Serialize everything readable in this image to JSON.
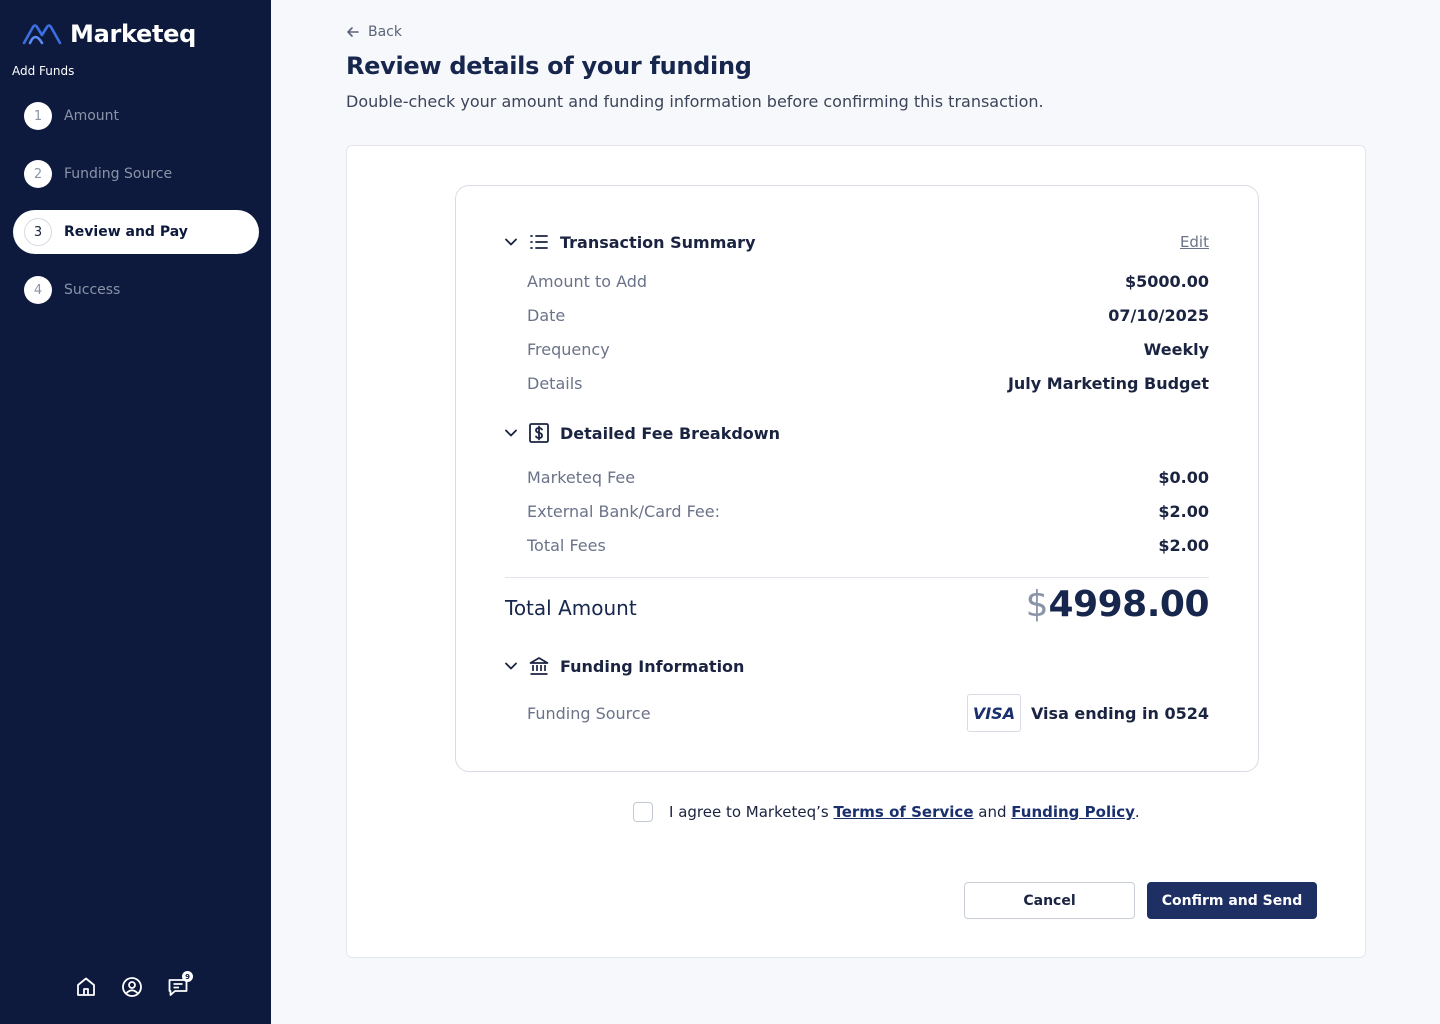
{
  "brand": {
    "name": "Marketeq",
    "accent": "#3b82f6",
    "sidebar_bg": "#0e1a3d",
    "primary_button": "#1d2f63"
  },
  "sidebar": {
    "heading": "Add Funds",
    "steps": [
      {
        "num": "1",
        "label": "Amount",
        "active": false
      },
      {
        "num": "2",
        "label": "Funding Source",
        "active": false
      },
      {
        "num": "3",
        "label": "Review and Pay",
        "active": true
      },
      {
        "num": "4",
        "label": "Success",
        "active": false
      }
    ],
    "bottom_icons": [
      "home-icon",
      "profile-icon",
      "messages-icon"
    ],
    "messages_badge": "9"
  },
  "header": {
    "back_label": "Back",
    "title": "Review details of your funding",
    "subtitle": "Double-check your amount and funding information before confirming this transaction."
  },
  "transaction_summary": {
    "title": "Transaction Summary",
    "edit_label": "Edit",
    "rows": [
      {
        "label": "Amount to Add",
        "value": "$5000.00"
      },
      {
        "label": "Date",
        "value": "07/10/2025"
      },
      {
        "label": "Frequency",
        "value": "Weekly"
      },
      {
        "label": "Details",
        "value": "July Marketing Budget"
      }
    ]
  },
  "fee_breakdown": {
    "title": "Detailed Fee Breakdown",
    "rows": [
      {
        "label": "Marketeq Fee",
        "value": "$0.00"
      },
      {
        "label": "External Bank/Card Fee:",
        "value": "$2.00"
      },
      {
        "label": "Total Fees",
        "value": "$2.00"
      }
    ]
  },
  "total": {
    "label": "Total Amount",
    "currency": "$",
    "value": "4998.00"
  },
  "funding_info": {
    "title": "Funding Information",
    "source_label": "Funding Source",
    "card_brand": "VISA",
    "card_text": "Visa ending in 0524"
  },
  "agreement": {
    "prefix": "I agree to Marketeq’s ",
    "terms": "Terms of Service",
    "middle": " and ",
    "policy": "Funding Policy",
    "suffix": "."
  },
  "actions": {
    "cancel": "Cancel",
    "confirm": "Confirm and Send"
  }
}
